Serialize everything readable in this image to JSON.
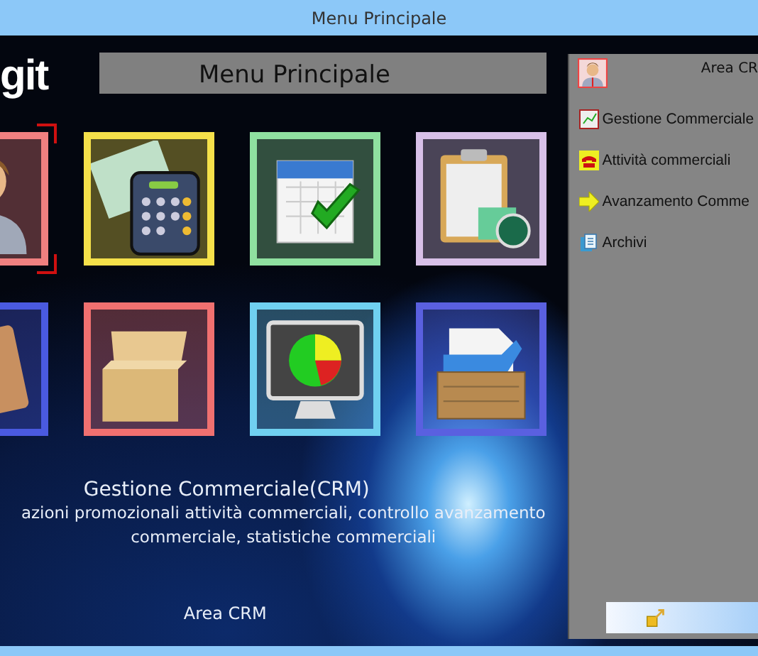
{
  "window": {
    "title": "Menu Principale"
  },
  "logo": {
    "text": "git"
  },
  "header": {
    "title": "Menu Principale"
  },
  "tiles": [
    {
      "kind": "person",
      "color": "#f08080",
      "selected": true
    },
    {
      "kind": "calculator",
      "color": "#f5e04a",
      "selected": false
    },
    {
      "kind": "calendar",
      "color": "#8fe0a0",
      "selected": false
    },
    {
      "kind": "clipboard",
      "color": "#d8c0e8",
      "selected": false
    },
    {
      "kind": "book",
      "color": "#4a5ae0",
      "selected": false
    },
    {
      "kind": "boxes",
      "color": "#f07070",
      "selected": false
    },
    {
      "kind": "monitor",
      "color": "#70d0f0",
      "selected": false
    },
    {
      "kind": "crate",
      "color": "#5a60e0",
      "selected": false
    }
  ],
  "info": {
    "title": "Gestione Commerciale(CRM)",
    "description_lines": [
      "azioni promozionali attività commerciali, controllo avanzamento",
      "commerciale, statistiche commerciali"
    ],
    "area": "Area CRM"
  },
  "side_panel": {
    "title": "Area CR",
    "items": [
      {
        "kind": "chart",
        "label": "Gestione Commerciale"
      },
      {
        "kind": "phone",
        "label": "Attività commerciali"
      },
      {
        "kind": "arrow",
        "label": "Avanzamento Comme"
      },
      {
        "kind": "document",
        "label": "Archivi"
      }
    ]
  }
}
